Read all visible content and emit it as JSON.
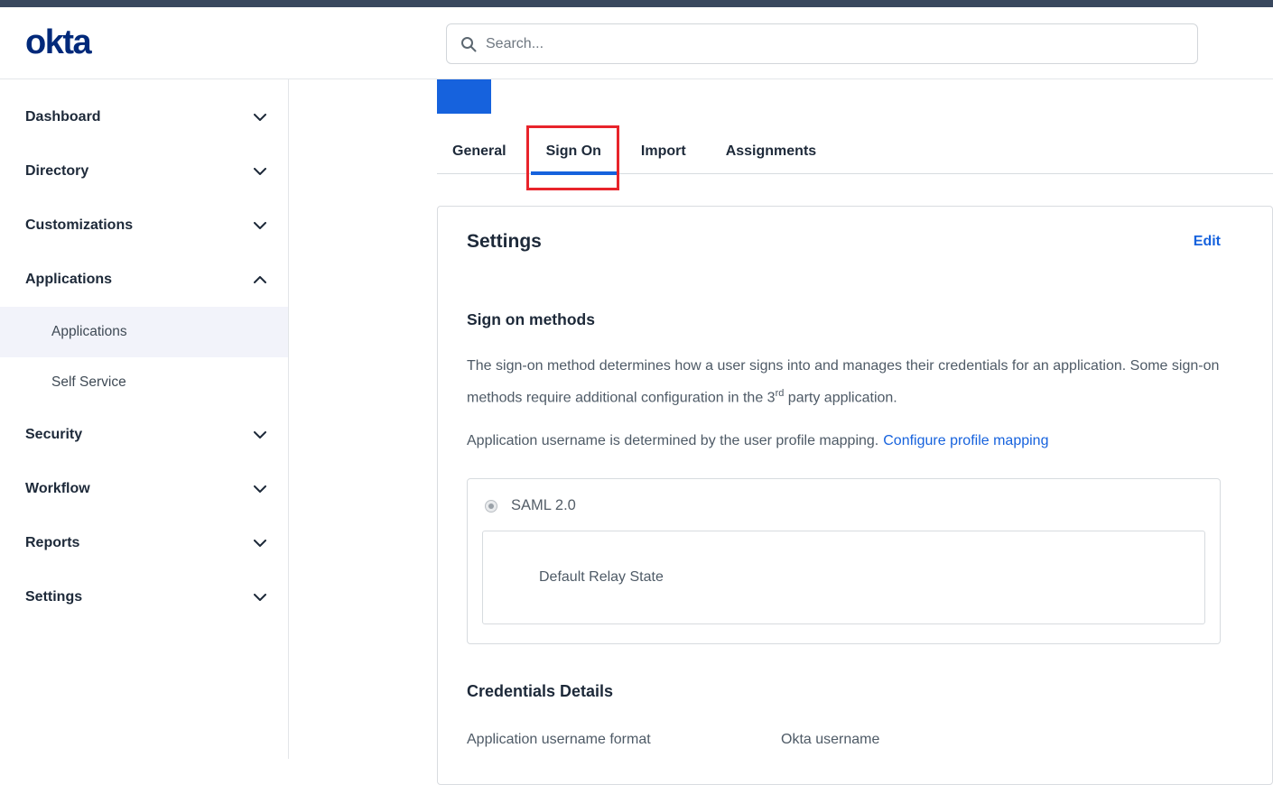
{
  "colors": {
    "accent_blue": "#1662dd",
    "logo_navy": "#00297a",
    "annotation_red": "#e8242b"
  },
  "topbar": {
    "logo_text": "okta",
    "search_placeholder": "Search..."
  },
  "sidebar": {
    "items": [
      {
        "label": "Dashboard"
      },
      {
        "label": "Directory"
      },
      {
        "label": "Customizations"
      },
      {
        "label": "Applications"
      },
      {
        "label": "Security"
      },
      {
        "label": "Workflow"
      },
      {
        "label": "Reports"
      },
      {
        "label": "Settings"
      }
    ],
    "applications_children": [
      {
        "label": "Applications"
      },
      {
        "label": "Self Service"
      }
    ]
  },
  "tabs": {
    "general": "General",
    "sign_on": "Sign On",
    "import": "Import",
    "assignments": "Assignments"
  },
  "settings_card": {
    "title": "Settings",
    "edit_link": "Edit",
    "sign_on_methods": {
      "heading": "Sign on methods",
      "desc_part1": "The sign-on method determines how a user signs into and manages their credentials for an application. Some sign-on methods require additional configuration in the 3",
      "desc_sup": "rd",
      "desc_part2": " party application.",
      "mapping_text": "Application username is determined by the user profile mapping.",
      "mapping_link": "Configure profile mapping"
    },
    "saml": {
      "radio_label": "SAML 2.0",
      "field_label": "Default Relay State"
    },
    "credentials": {
      "heading": "Credentials Details",
      "row_label": "Application username format",
      "row_value": "Okta username"
    }
  }
}
